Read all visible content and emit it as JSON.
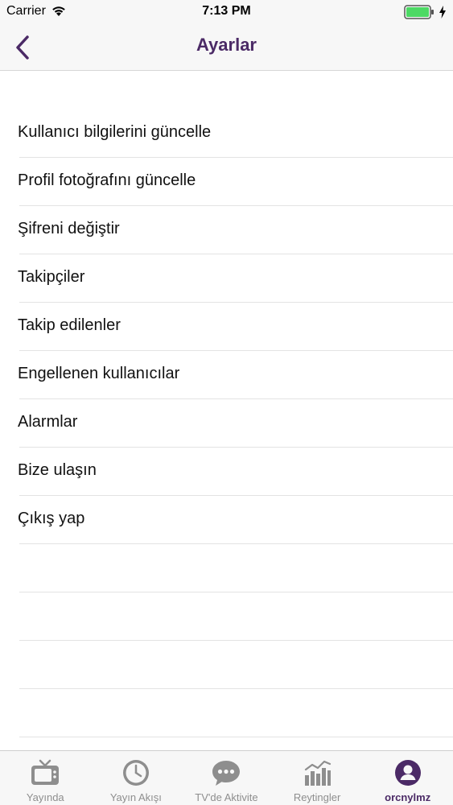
{
  "status_bar": {
    "carrier": "Carrier",
    "time": "7:13 PM"
  },
  "nav": {
    "title": "Ayarlar",
    "back_icon": "chevron-left-icon"
  },
  "settings": {
    "items": [
      {
        "label": "Kullanıcı bilgilerini güncelle"
      },
      {
        "label": "Profil fotoğrafını güncelle"
      },
      {
        "label": "Şifreni değiştir"
      },
      {
        "label": "Takipçiler"
      },
      {
        "label": "Takip edilenler"
      },
      {
        "label": "Engellenen kullanıcılar"
      },
      {
        "label": "Alarmlar"
      },
      {
        "label": "Bize ulaşın"
      },
      {
        "label": "Çıkış yap"
      }
    ]
  },
  "tab_bar": {
    "tabs": [
      {
        "label": "Yayında",
        "icon": "tv-icon",
        "active": false
      },
      {
        "label": "Yayın Akışı",
        "icon": "clock-icon",
        "active": false
      },
      {
        "label": "TV'de Aktivite",
        "icon": "chat-bubble-icon",
        "active": false
      },
      {
        "label": "Reytingler",
        "icon": "bar-chart-icon",
        "active": false
      },
      {
        "label": "orcnylmz",
        "icon": "profile-icon",
        "active": true
      }
    ]
  },
  "colors": {
    "accent": "#4b2a66",
    "inactive_tab": "#8e8e8e",
    "battery": "#4cd964"
  }
}
